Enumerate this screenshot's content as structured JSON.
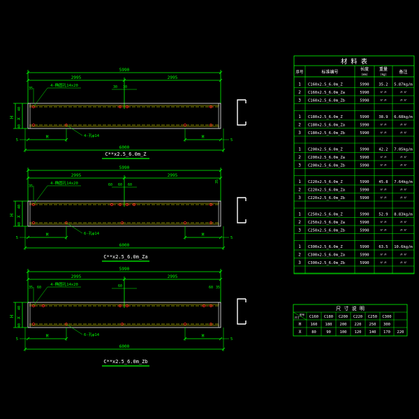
{
  "colors": {
    "background": "#000000",
    "dimension": "#00ff00",
    "outline": "#ffffff",
    "flange": "#ffff00",
    "holes": "#ff2020",
    "table_text": "#ffffff",
    "title": "#ffffff",
    "title_underline": "#00ff00",
    "accent": "#00ffff"
  },
  "views": [
    {
      "title": "C**x2.5_6.0m_Z",
      "overall": "5990",
      "half_left": "2995",
      "half_right": "2995",
      "bottom_dim": "6000",
      "m_left": "M",
      "m_right": "M",
      "end_left": "5",
      "end_right": "5",
      "h_label": "H",
      "x_label": "X",
      "edge_40": "40",
      "edge_35": "35",
      "hole_note_top": "4-椭圆孔14x20",
      "hole_note_bottom": "4-孔φ14",
      "small_dims": [
        "30",
        "30"
      ]
    },
    {
      "title": "C**x2.5_6.0m_Za",
      "overall": "5990",
      "half_left": "2995",
      "half_right": "2995",
      "bottom_dim": "6000",
      "m_left": "M",
      "m_right": "M",
      "end_left": "5",
      "end_right": "5",
      "h_label": "H",
      "x_label": "X",
      "edge_40": "40",
      "edge_35": "35",
      "edge_35_right": "35",
      "hole_note_top": "4-椭圆孔14x20",
      "hole_note_bottom": "6-孔φ14",
      "small_dims": [
        "60",
        "60",
        "60"
      ]
    },
    {
      "title": "C**x2.5_6.0m_Zb",
      "overall": "5990",
      "half_left": "2995",
      "half_right": "2995",
      "bottom_dim": "6000",
      "m_left": "M",
      "m_right": "M",
      "end_left": "5",
      "end_right": "5",
      "h_label": "H",
      "x_label": "X",
      "edge_40": "40",
      "edge_35": "35",
      "edge_60": "60",
      "edge_60_right": "60",
      "edge_35_right": "35",
      "hole_note_top": "4-椭圆孔14x20",
      "hole_note_bottom": "6-孔φ14",
      "small_dims": [
        "60"
      ]
    }
  ],
  "materials": {
    "title": "材 料 表",
    "headers": {
      "no": "序号",
      "name": "标准编号",
      "length": "长度",
      "length_unit": "(mm)",
      "weight": "重量",
      "weight_unit": "(kg)",
      "note": "备注"
    },
    "groups": [
      {
        "rows": [
          [
            "1",
            "C160x2.5_6.0m_Z",
            "5990",
            "35.2",
            "5.87kg/m"
          ],
          [
            "2",
            "C160x2.5_6.0m_Za",
            "5990",
            "〃〃",
            "〃〃"
          ],
          [
            "3",
            "C160x2.5_6.0m_Zb",
            "5990",
            "〃〃",
            "〃〃"
          ]
        ]
      },
      {
        "rows": [
          [
            "1",
            "C180x2.5_6.0m_Z",
            "5990",
            "38.9",
            "6.68kg/m"
          ],
          [
            "2",
            "C180x2.5_6.0m_Za",
            "5990",
            "〃〃",
            "〃〃"
          ],
          [
            "3",
            "C180x2.5_6.0m_Zb",
            "5990",
            "〃〃",
            "〃〃"
          ]
        ]
      },
      {
        "rows": [
          [
            "1",
            "C200x2.5_6.0m_Z",
            "5990",
            "42.2",
            "7.05kg/m"
          ],
          [
            "2",
            "C200x2.5_6.0m_Za",
            "5990",
            "〃〃",
            "〃〃"
          ],
          [
            "3",
            "C200x2.5_6.0m_Zb",
            "5990",
            "〃〃",
            "〃〃"
          ]
        ]
      },
      {
        "rows": [
          [
            "1",
            "C220x2.5_6.0m_Z",
            "5990",
            "45.8",
            "7.64kg/m"
          ],
          [
            "2",
            "C220x2.5_6.0m_Za",
            "5990",
            "〃〃",
            "〃〃"
          ],
          [
            "3",
            "C220x2.5_6.0m_Zb",
            "5990",
            "〃〃",
            "〃〃"
          ]
        ]
      },
      {
        "rows": [
          [
            "1",
            "C250x2.5_6.0m_Z",
            "5990",
            "52.9",
            "8.83kg/m"
          ],
          [
            "2",
            "C250x2.5_6.0m_Za",
            "5990",
            "〃〃",
            "〃〃"
          ],
          [
            "3",
            "C250x2.5_6.0m_Zb",
            "5990",
            "〃〃",
            "〃〃"
          ]
        ]
      },
      {
        "rows": [
          [
            "1",
            "C300x2.5_6.0m_Z",
            "5990",
            "63.5",
            "10.6kg/m"
          ],
          [
            "2",
            "C300x2.5_6.0m_Za",
            "5990",
            "〃〃",
            "〃〃"
          ],
          [
            "3",
            "C300x2.5_6.0m_Zb",
            "5990",
            "〃〃",
            "〃〃"
          ]
        ]
      }
    ]
  },
  "dimensions_table": {
    "title": "尺 寸 说 明",
    "corner_top": "型号",
    "corner_bottom": "尺寸",
    "columns": [
      "C160",
      "C180",
      "C200",
      "C220",
      "C250",
      "C300"
    ],
    "rows": [
      {
        "label": "H",
        "values": [
          "160",
          "180",
          "200",
          "220",
          "250",
          "300"
        ]
      },
      {
        "label": "X",
        "values": [
          "80",
          "90",
          "100",
          "120",
          "140",
          "170",
          "220"
        ]
      }
    ]
  }
}
